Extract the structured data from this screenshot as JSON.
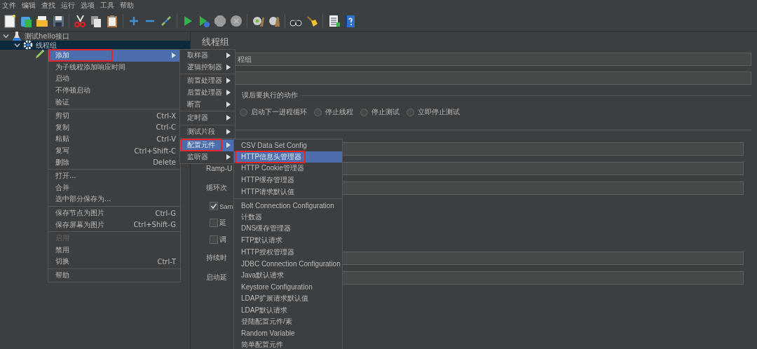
{
  "menubar": [
    "文件",
    "编辑",
    "查找",
    "运行",
    "选项",
    "工具",
    "帮助"
  ],
  "tree": [
    {
      "label": "测试hello接口",
      "kind": "plan",
      "expanded": true,
      "selected": false,
      "children": [
        {
          "label": "线程组",
          "kind": "group",
          "expanded": true,
          "selected": true,
          "children": [
            {
              "kind": "sampler",
              "selected": false
            }
          ]
        }
      ]
    }
  ],
  "thread_group": {
    "title": "线程组",
    "name_field": {
      "value": "程组"
    },
    "error_action": {
      "legend": "误后要执行的动作",
      "options": [
        {
          "label": "启动下一进程循环",
          "selected": false
        },
        {
          "label": "停止线程",
          "selected": false
        },
        {
          "label": "停止测试",
          "selected": false
        },
        {
          "label": "立即停止测试",
          "selected": false
        }
      ]
    },
    "properties": [
      {
        "kind": "field"
      },
      {
        "kind": "field",
        "label": "Ramp-U"
      },
      {
        "kind": "field",
        "label": "循环次"
      },
      {
        "kind": "checkbox",
        "label": "Sam",
        "checked": true
      },
      {
        "kind": "checkbox",
        "label": "延",
        "checked": false
      },
      {
        "kind": "checkbox",
        "label": "调",
        "checked": false
      },
      {
        "kind": "field",
        "label": "持续时",
        "disabled": true
      },
      {
        "kind": "field",
        "label": "启动延",
        "disabled": true
      }
    ]
  },
  "context_menus": [
    {
      "items": [
        {
          "kind": "item",
          "label": "添加",
          "submenu": true,
          "selected": true,
          "annotated": true
        },
        {
          "kind": "item",
          "label": "为子线程添加响应时间"
        },
        {
          "kind": "item",
          "label": "启动"
        },
        {
          "kind": "item",
          "label": "不停顿启动"
        },
        {
          "kind": "item",
          "label": "验证"
        },
        {
          "kind": "separator"
        },
        {
          "kind": "item",
          "label": "剪切",
          "shortcut": "Ctrl-X"
        },
        {
          "kind": "item",
          "label": "复制",
          "shortcut": "Ctrl-C"
        },
        {
          "kind": "item",
          "label": "粘贴",
          "shortcut": "Ctrl-V"
        },
        {
          "kind": "item",
          "label": "复写",
          "shortcut": "Ctrl+Shift-C"
        },
        {
          "kind": "item",
          "label": "删除",
          "shortcut": "Delete"
        },
        {
          "kind": "separator"
        },
        {
          "kind": "item",
          "label": "打开..."
        },
        {
          "kind": "item",
          "label": "合并"
        },
        {
          "kind": "item",
          "label": "选中部分保存为..."
        },
        {
          "kind": "separator"
        },
        {
          "kind": "item",
          "label": "保存节点为图片",
          "shortcut": "Ctrl-G"
        },
        {
          "kind": "item",
          "label": "保存屏幕为图片",
          "shortcut": "Ctrl+Shift-G"
        },
        {
          "kind": "separator"
        },
        {
          "kind": "item",
          "label": "启用",
          "disabled": true
        },
        {
          "kind": "item",
          "label": "禁用"
        },
        {
          "kind": "item",
          "label": "切换",
          "shortcut": "Ctrl-T"
        },
        {
          "kind": "separator"
        },
        {
          "kind": "item",
          "label": "帮助"
        }
      ]
    },
    {
      "items": [
        {
          "kind": "item",
          "label": "取样器",
          "submenu": true
        },
        {
          "kind": "item",
          "label": "逻辑控制器",
          "submenu": true
        },
        {
          "kind": "separator"
        },
        {
          "kind": "item",
          "label": "前置处理器",
          "submenu": true
        },
        {
          "kind": "item",
          "label": "后置处理器",
          "submenu": true
        },
        {
          "kind": "item",
          "label": "断言",
          "submenu": true
        },
        {
          "kind": "separator"
        },
        {
          "kind": "item",
          "label": "定时器",
          "submenu": true
        },
        {
          "kind": "separator"
        },
        {
          "kind": "item",
          "label": "测试片段",
          "submenu": true
        },
        {
          "kind": "separator"
        },
        {
          "kind": "item",
          "label": "配置元件",
          "submenu": true,
          "selected": true,
          "annotated": true
        },
        {
          "kind": "item",
          "label": "监听器",
          "submenu": true
        }
      ]
    },
    {
      "items": [
        {
          "kind": "item",
          "label": "CSV Data Set Config"
        },
        {
          "kind": "item",
          "label": "HTTP信息头管理器",
          "selected": true,
          "annotated": true
        },
        {
          "kind": "item",
          "label": "HTTP Cookie管理器"
        },
        {
          "kind": "item",
          "label": "HTTP缓存管理器"
        },
        {
          "kind": "item",
          "label": "HTTP请求默认值"
        },
        {
          "kind": "separator"
        },
        {
          "kind": "item",
          "label": "Bolt Connection Configuration"
        },
        {
          "kind": "item",
          "label": "计数器"
        },
        {
          "kind": "item",
          "label": "DNS缓存管理器"
        },
        {
          "kind": "item",
          "label": "FTP默认请求"
        },
        {
          "kind": "item",
          "label": "HTTP授权管理器"
        },
        {
          "kind": "item",
          "label": "JDBC Connection Configuration"
        },
        {
          "kind": "item",
          "label": "Java默认请求"
        },
        {
          "kind": "item",
          "label": "Keystore Configuration"
        },
        {
          "kind": "item",
          "label": "LDAP扩展请求默认值"
        },
        {
          "kind": "item",
          "label": "LDAP默认请求"
        },
        {
          "kind": "item",
          "label": "登陆配置元件/素"
        },
        {
          "kind": "item",
          "label": "Random Variable"
        },
        {
          "kind": "item",
          "label": "简单配置元件"
        }
      ]
    }
  ]
}
